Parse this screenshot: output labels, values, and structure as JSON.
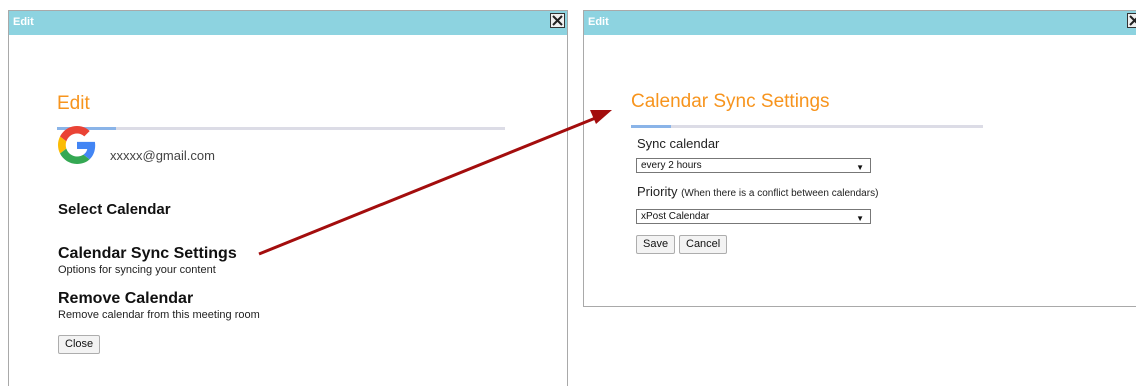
{
  "left_dialog": {
    "window_title": "Edit",
    "heading": "Edit",
    "email": "xxxxx@gmail.com",
    "select_calendar": "Select Calendar",
    "items": [
      {
        "title": "Calendar Sync Settings",
        "desc": "Options for syncing your content"
      },
      {
        "title": "Remove Calendar",
        "desc": "Remove calendar from this meeting room"
      }
    ],
    "close_label": "Close"
  },
  "right_dialog": {
    "window_title": "Edit",
    "heading": "Calendar Sync Settings",
    "sync_label": "Sync calendar",
    "sync_value": "every 2 hours",
    "priority_label": "Priority",
    "priority_note": "(When there is a conflict between calendars)",
    "priority_value": "xPost Calendar",
    "save_label": "Save",
    "cancel_label": "Cancel"
  },
  "colors": {
    "titlebar": "#8dd3e0",
    "heading": "#f7941d",
    "arrow": "#a30d0d",
    "accent_rule": "#8ab4e8"
  }
}
